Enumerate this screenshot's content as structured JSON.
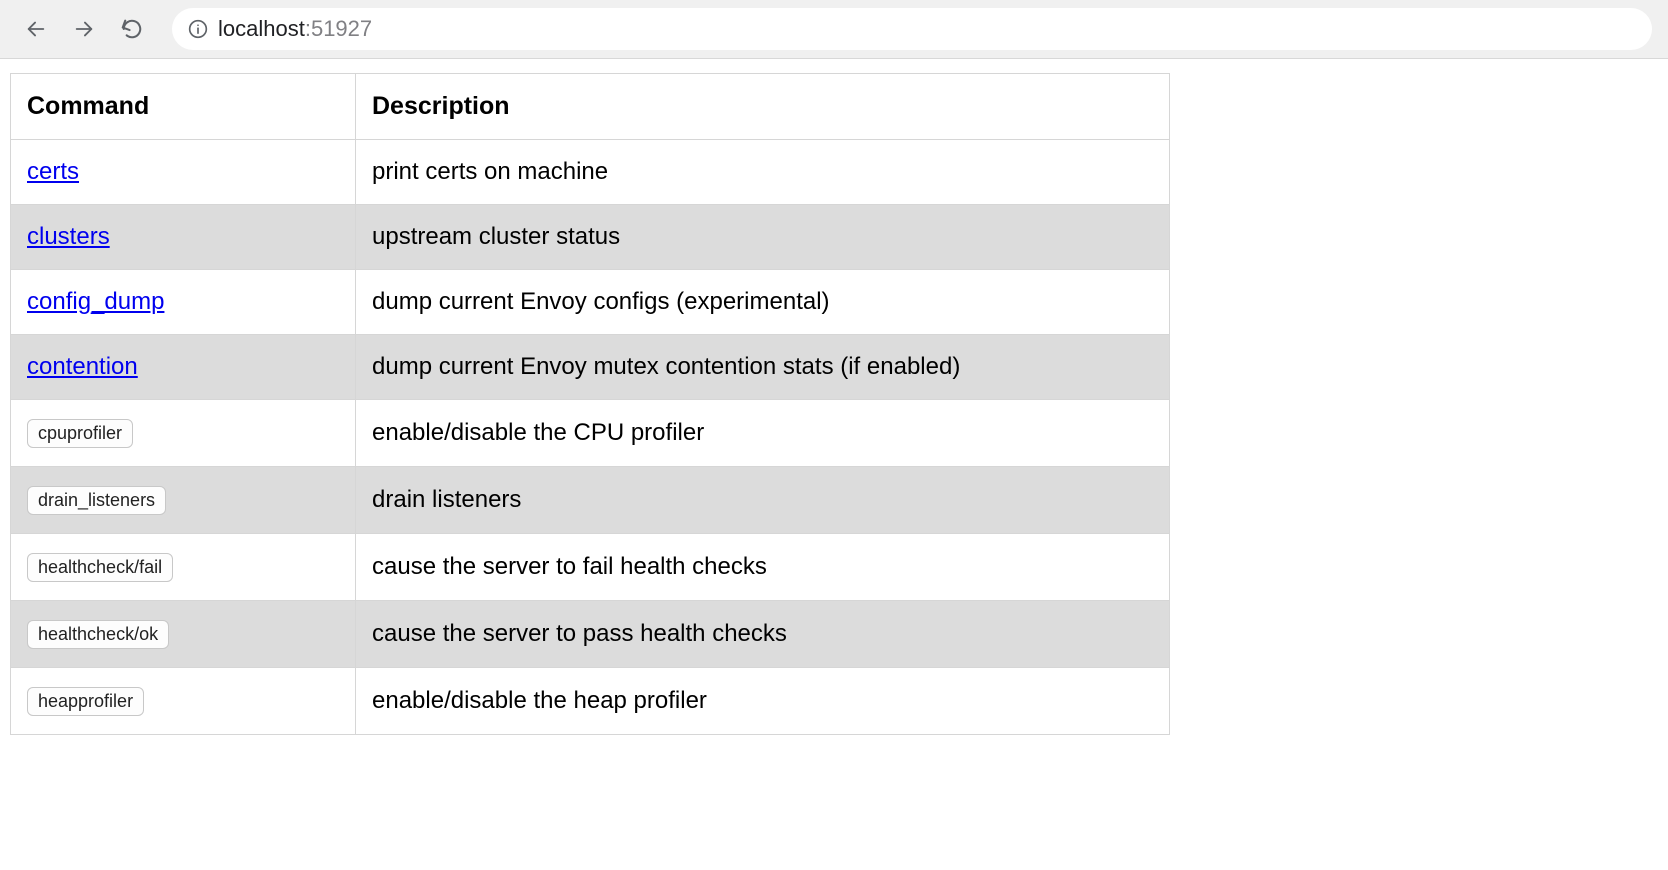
{
  "address": {
    "host": "localhost",
    "port": ":51927"
  },
  "table": {
    "headers": {
      "command": "Command",
      "description": "Description"
    },
    "rows": [
      {
        "type": "link",
        "command": "certs",
        "description": "print certs on machine"
      },
      {
        "type": "link",
        "command": "clusters",
        "description": "upstream cluster status"
      },
      {
        "type": "link",
        "command": "config_dump",
        "description": "dump current Envoy configs (experimental)"
      },
      {
        "type": "link",
        "command": "contention",
        "description": "dump current Envoy mutex contention stats (if enabled)"
      },
      {
        "type": "button",
        "command": "cpuprofiler",
        "description": "enable/disable the CPU profiler"
      },
      {
        "type": "button",
        "command": "drain_listeners",
        "description": "drain listeners"
      },
      {
        "type": "button",
        "command": "healthcheck/fail",
        "description": "cause the server to fail health checks"
      },
      {
        "type": "button",
        "command": "healthcheck/ok",
        "description": "cause the server to pass health checks"
      },
      {
        "type": "button",
        "command": "heapprofiler",
        "description": "enable/disable the heap profiler"
      }
    ]
  }
}
